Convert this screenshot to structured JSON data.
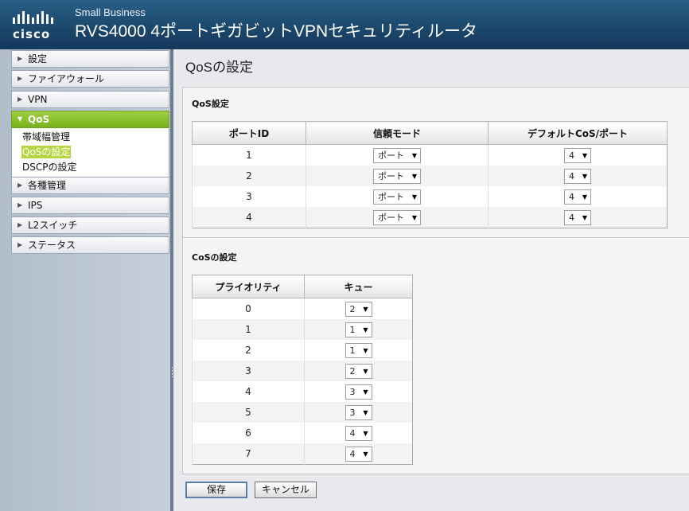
{
  "header": {
    "logo_text": "cisco",
    "brand_sub": "Small Business",
    "title": "RVS4000 4ポートギガビットVPNセキュリティルータ"
  },
  "sidebar": {
    "items": [
      {
        "label": "設定",
        "arrow": "▶"
      },
      {
        "label": "ファイアウォール",
        "arrow": "▶"
      },
      {
        "label": "VPN",
        "arrow": "▶"
      },
      {
        "label": "QoS",
        "arrow": "▼",
        "active": true
      },
      {
        "label": "各種管理",
        "arrow": "▶"
      },
      {
        "label": "IPS",
        "arrow": "▶"
      },
      {
        "label": "L2スイッチ",
        "arrow": "▶"
      },
      {
        "label": "ステータス",
        "arrow": "▶"
      }
    ],
    "qos_sub": [
      {
        "label": "帯域幅管理"
      },
      {
        "label": "QoSの設定",
        "selected": true
      },
      {
        "label": "DSCPの設定"
      }
    ]
  },
  "main": {
    "title": "QoSの設定",
    "qos_section_title": "QoS設定",
    "qos_table": {
      "headers": [
        "ポートID",
        "信頼モード",
        "デフォルトCoS/ポート"
      ],
      "rows": [
        {
          "port": "1",
          "trust": "ポート",
          "cos": "4"
        },
        {
          "port": "2",
          "trust": "ポート",
          "cos": "4"
        },
        {
          "port": "3",
          "trust": "ポート",
          "cos": "4"
        },
        {
          "port": "4",
          "trust": "ポート",
          "cos": "4"
        }
      ]
    },
    "cos_section_title": "CoSの設定",
    "cos_table": {
      "headers": [
        "プライオリティ",
        "キュー"
      ],
      "rows": [
        {
          "priority": "0",
          "queue": "2"
        },
        {
          "priority": "1",
          "queue": "1"
        },
        {
          "priority": "2",
          "queue": "1"
        },
        {
          "priority": "3",
          "queue": "2"
        },
        {
          "priority": "4",
          "queue": "3"
        },
        {
          "priority": "5",
          "queue": "3"
        },
        {
          "priority": "6",
          "queue": "4"
        },
        {
          "priority": "7",
          "queue": "4"
        }
      ]
    },
    "buttons": {
      "save": "保存",
      "cancel": "キャンセル"
    }
  },
  "colors": {
    "header_bg": "#1e4d71",
    "active_nav": "#8ac130",
    "selected_sub": "#b6d543"
  }
}
